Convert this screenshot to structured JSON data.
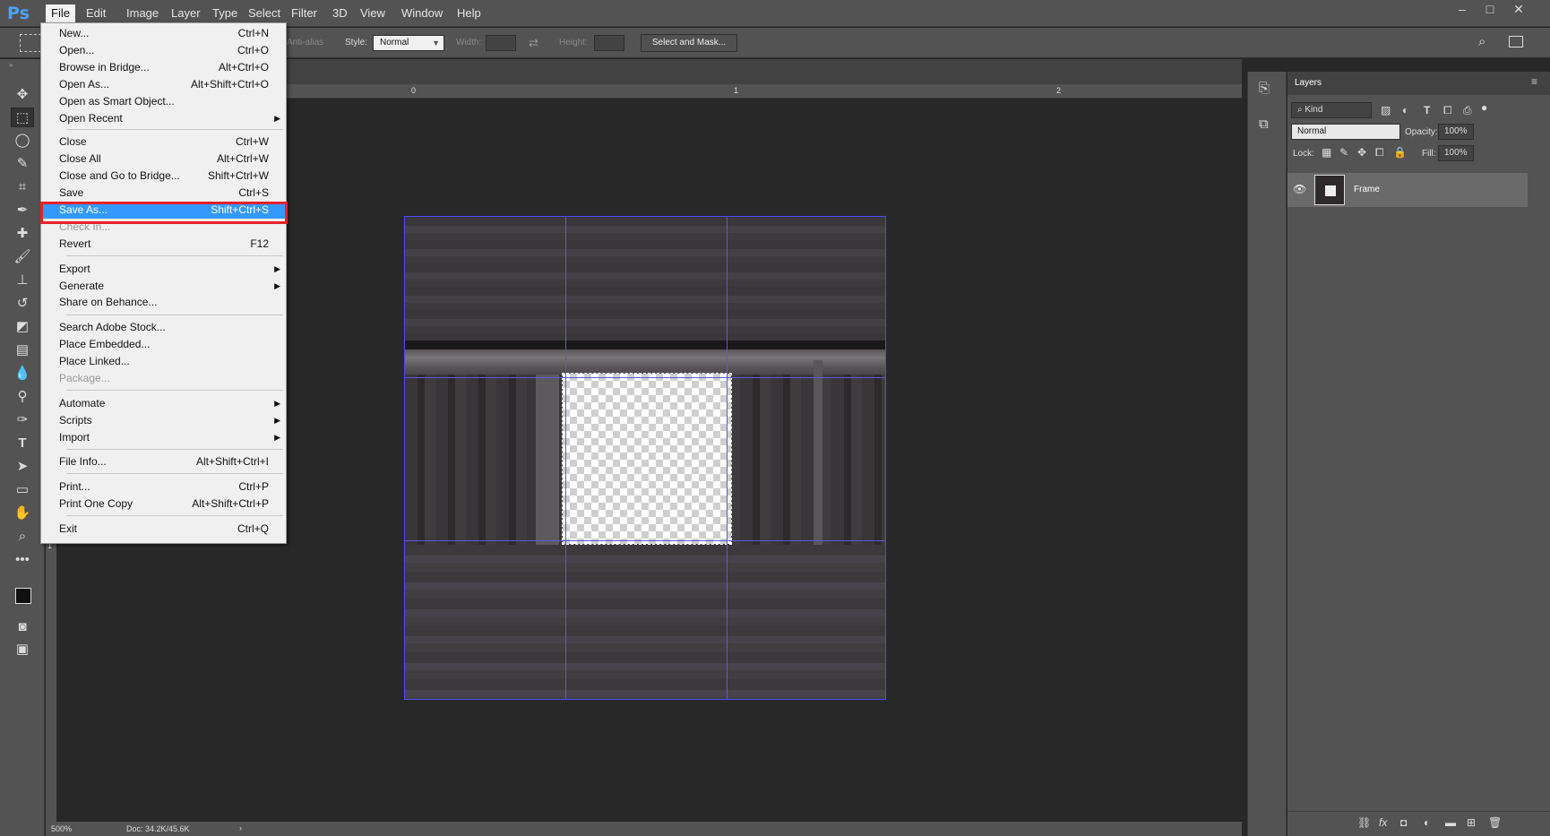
{
  "app": {
    "logo": "Ps"
  },
  "menubar": {
    "items": [
      "File",
      "Edit",
      "Image",
      "Layer",
      "Type",
      "Select",
      "Filter",
      "3D",
      "View",
      "Window",
      "Help"
    ]
  },
  "window_controls": {
    "minimize": "–",
    "maximize": "□",
    "close": "✕"
  },
  "options": {
    "anti_alias": "Anti-alias",
    "style_label": "Style:",
    "style_value": "Normal",
    "width_label": "Width:",
    "height_label": "Height:",
    "select_mask": "Select and Mask..."
  },
  "rulers": {
    "top": [
      "0",
      "1",
      "2"
    ],
    "left": [
      "1"
    ]
  },
  "status": {
    "zoom": "500%",
    "doc": "Doc: 34.2K/45.6K"
  },
  "file_menu": {
    "items": [
      {
        "label": "New...",
        "shortcut": "Ctrl+N"
      },
      {
        "label": "Open...",
        "shortcut": "Ctrl+O"
      },
      {
        "label": "Browse in Bridge...",
        "shortcut": "Alt+Ctrl+O"
      },
      {
        "label": "Open As...",
        "shortcut": "Alt+Shift+Ctrl+O"
      },
      {
        "label": "Open as Smart Object...",
        "shortcut": ""
      },
      {
        "label": "Open Recent",
        "shortcut": "",
        "submenu": true
      },
      {
        "label": "Close",
        "shortcut": "Ctrl+W"
      },
      {
        "label": "Close All",
        "shortcut": "Alt+Ctrl+W"
      },
      {
        "label": "Close and Go to Bridge...",
        "shortcut": "Shift+Ctrl+W"
      },
      {
        "label": "Save",
        "shortcut": "Ctrl+S"
      },
      {
        "label": "Save As...",
        "shortcut": "Shift+Ctrl+S",
        "highlighted": true
      },
      {
        "label": "Check In...",
        "shortcut": "",
        "disabled": true
      },
      {
        "label": "Revert",
        "shortcut": "F12"
      },
      {
        "label": "Export",
        "shortcut": "",
        "submenu": true
      },
      {
        "label": "Generate",
        "shortcut": "",
        "submenu": true
      },
      {
        "label": "Share on Behance...",
        "shortcut": ""
      },
      {
        "label": "Search Adobe Stock...",
        "shortcut": ""
      },
      {
        "label": "Place Embedded...",
        "shortcut": ""
      },
      {
        "label": "Place Linked...",
        "shortcut": ""
      },
      {
        "label": "Package...",
        "shortcut": "",
        "disabled": true
      },
      {
        "label": "Automate",
        "shortcut": "",
        "submenu": true
      },
      {
        "label": "Scripts",
        "shortcut": "",
        "submenu": true
      },
      {
        "label": "Import",
        "shortcut": "",
        "submenu": true
      },
      {
        "label": "File Info...",
        "shortcut": "Alt+Shift+Ctrl+I"
      },
      {
        "label": "Print...",
        "shortcut": "Ctrl+P"
      },
      {
        "label": "Print One Copy",
        "shortcut": "Alt+Shift+Ctrl+P"
      },
      {
        "label": "Exit",
        "shortcut": "Ctrl+Q"
      }
    ]
  },
  "layers": {
    "title": "Layers",
    "kind": "Kind",
    "blend": "Normal",
    "opacity_label": "Opacity:",
    "opacity": "100%",
    "lock_label": "Lock:",
    "fill_label": "Fill:",
    "fill": "100%",
    "layer_name": "Frame"
  },
  "colors": {
    "highlight_box": "#e8212a",
    "menu_hover": "#3399ff",
    "ps_blue": "#4aa3ff"
  }
}
